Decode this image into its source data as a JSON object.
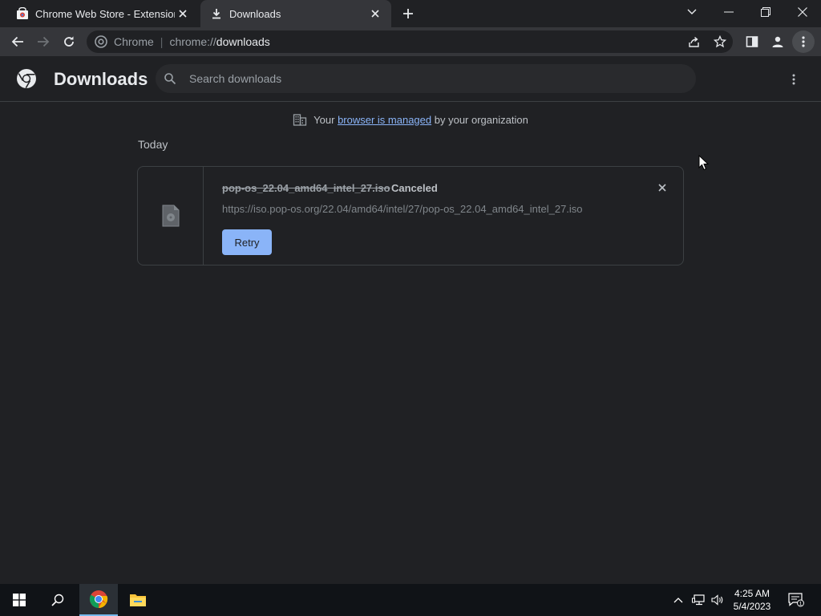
{
  "tabs": [
    {
      "title": "Chrome Web Store - Extensions",
      "active": false,
      "icon": "chrome-web-store-icon"
    },
    {
      "title": "Downloads",
      "active": true,
      "icon": "download-icon"
    }
  ],
  "omnibox": {
    "chip": "Chrome",
    "scheme": "chrome://",
    "host": "downloads"
  },
  "header": {
    "title": "Downloads",
    "search_placeholder": "Search downloads"
  },
  "managed_notice": {
    "prefix": "Your",
    "link": "browser is managed",
    "suffix": "by your organization"
  },
  "section_label": "Today",
  "download": {
    "file_name": "pop-os_22.04_amd64_intel_27.iso",
    "status": "Canceled",
    "url": "https://iso.pop-os.org/22.04/amd64/intel/27/pop-os_22.04_amd64_intel_27.iso",
    "retry_label": "Retry"
  },
  "taskbar": {
    "time": "4:25 AM",
    "date": "5/4/2023",
    "notification_count": "1"
  },
  "colors": {
    "accent": "#8ab4f8",
    "background": "#202124",
    "toolbar": "#35363a"
  }
}
